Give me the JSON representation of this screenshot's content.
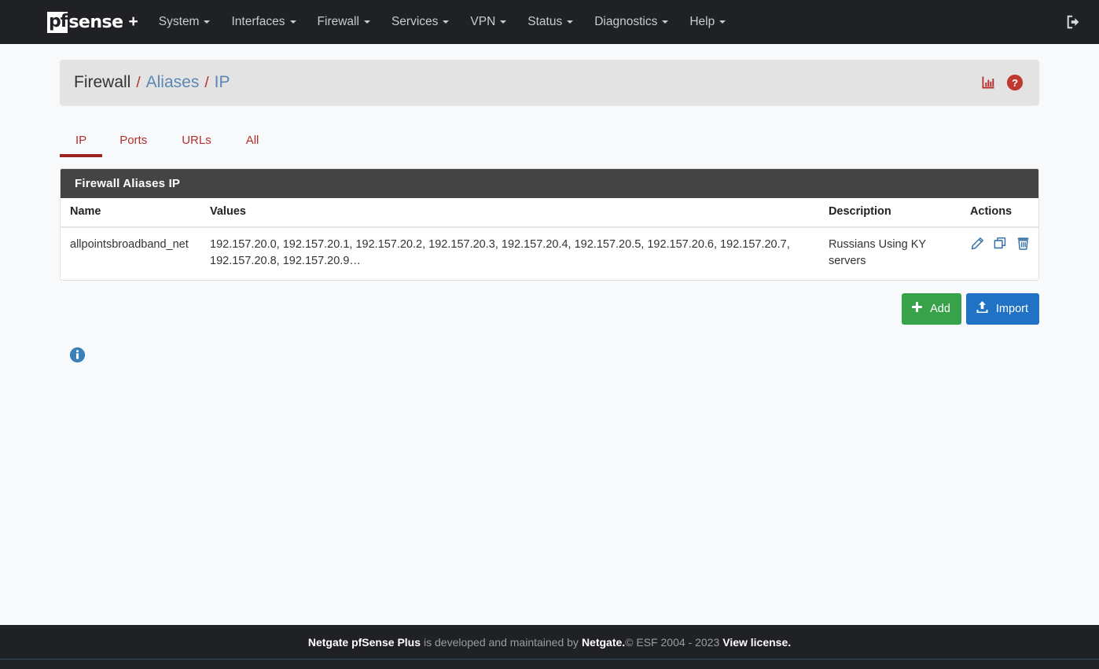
{
  "navbar": {
    "brand": {
      "mark": "pf",
      "word": "sense",
      "plus": "+"
    },
    "items": [
      {
        "label": "System",
        "icon": "chevron-down-icon"
      },
      {
        "label": "Interfaces",
        "icon": "chevron-down-icon"
      },
      {
        "label": "Firewall",
        "icon": "chevron-down-icon"
      },
      {
        "label": "Services",
        "icon": "chevron-down-icon"
      },
      {
        "label": "VPN",
        "icon": "chevron-down-icon"
      },
      {
        "label": "Status",
        "icon": "chevron-down-icon"
      },
      {
        "label": "Diagnostics",
        "icon": "chevron-down-icon"
      },
      {
        "label": "Help",
        "icon": "chevron-down-icon"
      }
    ],
    "logout_icon": "sign-out-icon"
  },
  "breadcrumb": {
    "root": "Firewall",
    "sep": "/",
    "level1": "Aliases",
    "level2": "IP",
    "icons": [
      {
        "name": "chart-icon",
        "color": "#b3302c"
      },
      {
        "name": "help-circle-icon",
        "color": "#c0392f"
      }
    ]
  },
  "tabs": [
    {
      "label": "IP",
      "active": true
    },
    {
      "label": "Ports",
      "active": false
    },
    {
      "label": "URLs",
      "active": false
    },
    {
      "label": "All",
      "active": false
    }
  ],
  "panel": {
    "title": "Firewall Aliases IP",
    "columns": [
      "Name",
      "Values",
      "Description",
      "Actions"
    ],
    "rows": [
      {
        "name": "allpointsbroadband_net",
        "values": "192.157.20.0, 192.157.20.1, 192.157.20.2, 192.157.20.3, 192.157.20.4, 192.157.20.5, 192.157.20.6, 192.157.20.7, 192.157.20.8, 192.157.20.9…",
        "description": "Russians Using KY servers",
        "actions": [
          {
            "name": "edit-alias-icon",
            "title": "Edit"
          },
          {
            "name": "copy-alias-icon",
            "title": "Copy"
          },
          {
            "name": "delete-alias-icon",
            "title": "Delete"
          }
        ]
      }
    ]
  },
  "buttons": {
    "add": {
      "label": "Add",
      "icon": "plus-icon",
      "color": "#38a24a"
    },
    "import": {
      "label": "Import",
      "icon": "upload-icon",
      "color": "#2073c4"
    }
  },
  "info": {
    "icon": "info-circle-icon",
    "color": "#3a80b8"
  },
  "footer": {
    "product": "Netgate pfSense Plus",
    "mid": "is developed and maintained by",
    "company": "Netgate.",
    "copyright": "© ESF 2004 - 2023",
    "license": "View license."
  }
}
